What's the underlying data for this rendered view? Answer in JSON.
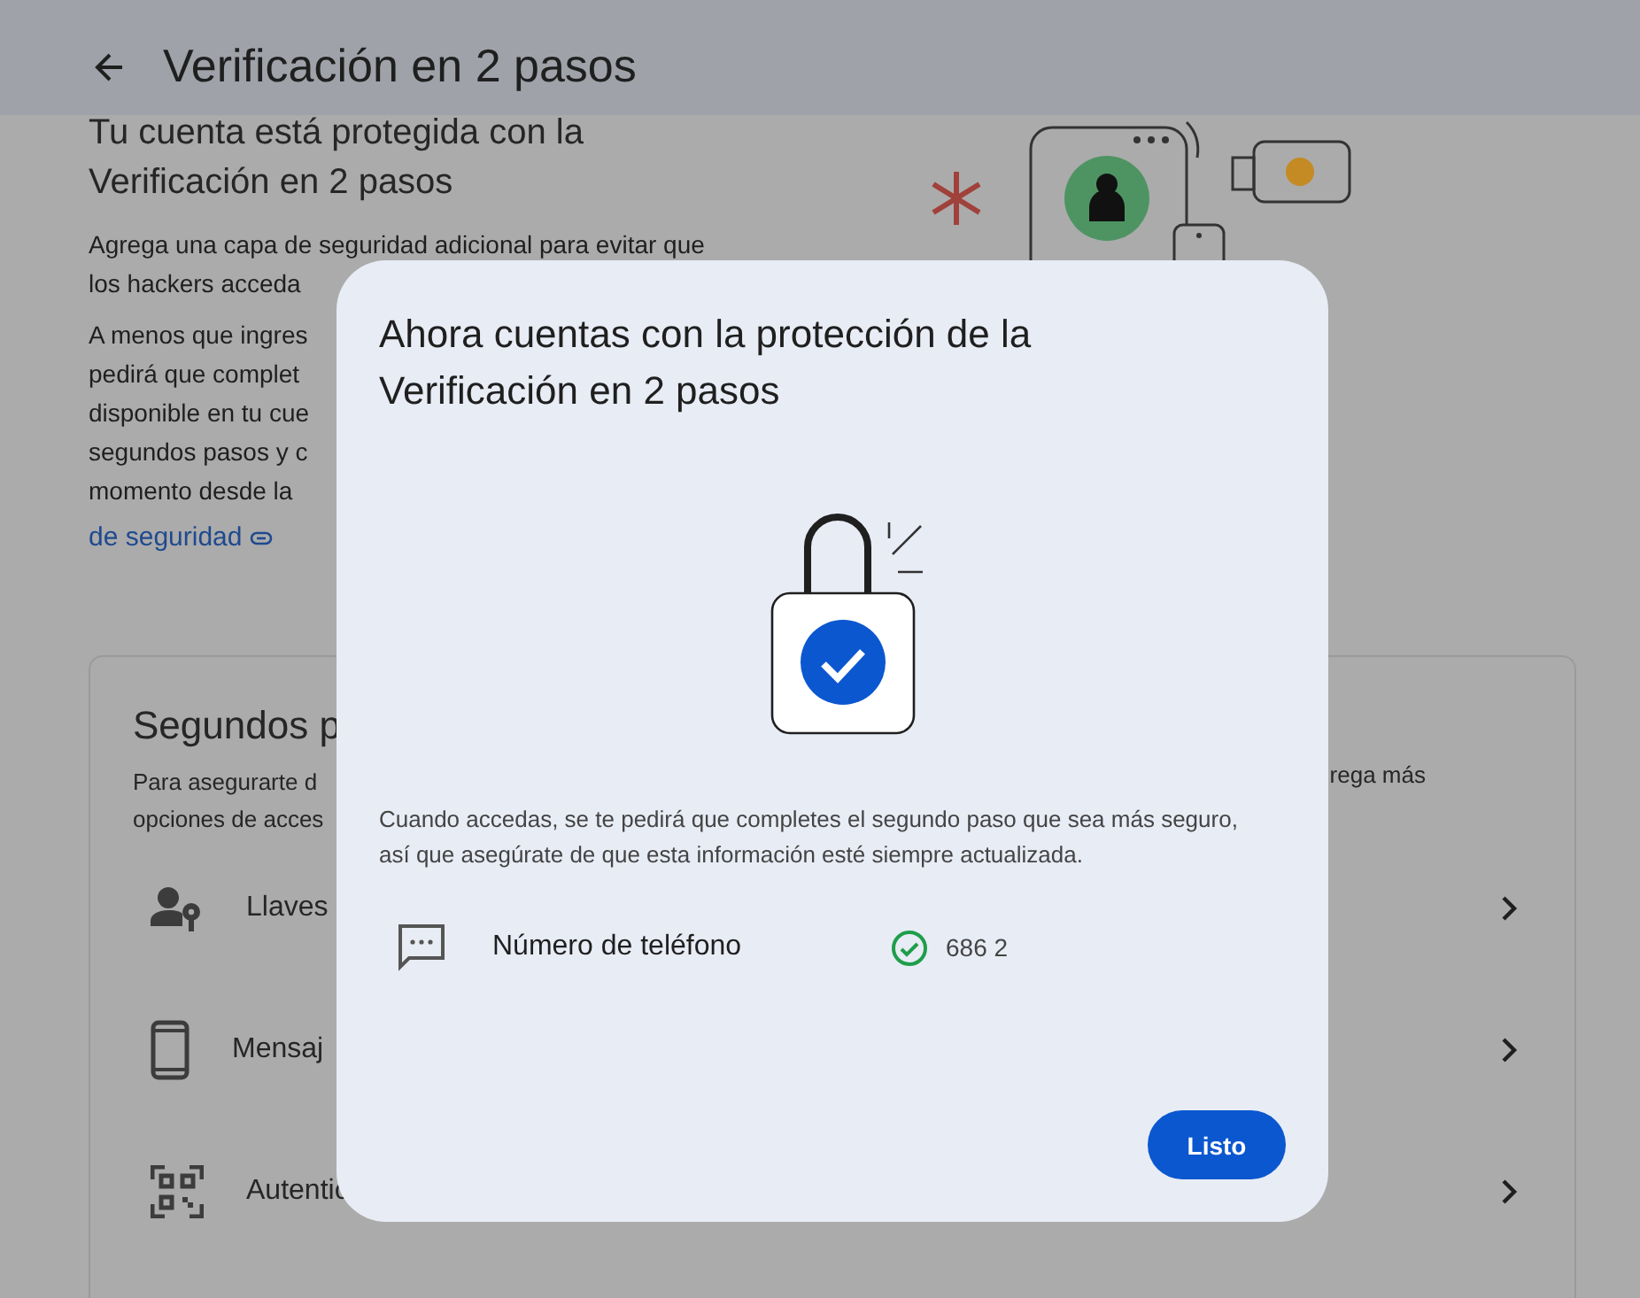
{
  "header": {
    "title": "Verificación en 2 pasos"
  },
  "intro": {
    "title_lines": [
      "Tu cuenta está protegida con la",
      "Verificación en 2 pasos"
    ],
    "paragraph_1_lines": [
      "Agrega una capa de seguridad adicional para evitar que",
      "los hackers acceda"
    ],
    "paragraph_2_lines": [
      "A menos que ingres",
      "pedirá que complet",
      "disponible en tu cue",
      "segundos pasos y c",
      "momento desde la"
    ],
    "link": "de seguridad"
  },
  "second_steps": {
    "title": "Segundos p",
    "description_lines": [
      "Para asegurarte d",
      "opciones de acces"
    ],
    "description_right": "rega más",
    "items": [
      {
        "label": "Llaves",
        "kind": "passkey"
      },
      {
        "label": "Mensaj",
        "kind": "phone"
      },
      {
        "label": "Autentic",
        "kind": "qr"
      }
    ]
  },
  "dialog": {
    "title": "Ahora cuentas con la protección de la Verificación en 2 pasos",
    "body": "Cuando accedas, se te pedirá que completes el segundo paso que sea más seguro, así que asegúrate de que esta información esté siempre actualizada.",
    "method": {
      "label": "Número de teléfono",
      "value": "686 2",
      "verified": true
    },
    "button": "Listo"
  }
}
